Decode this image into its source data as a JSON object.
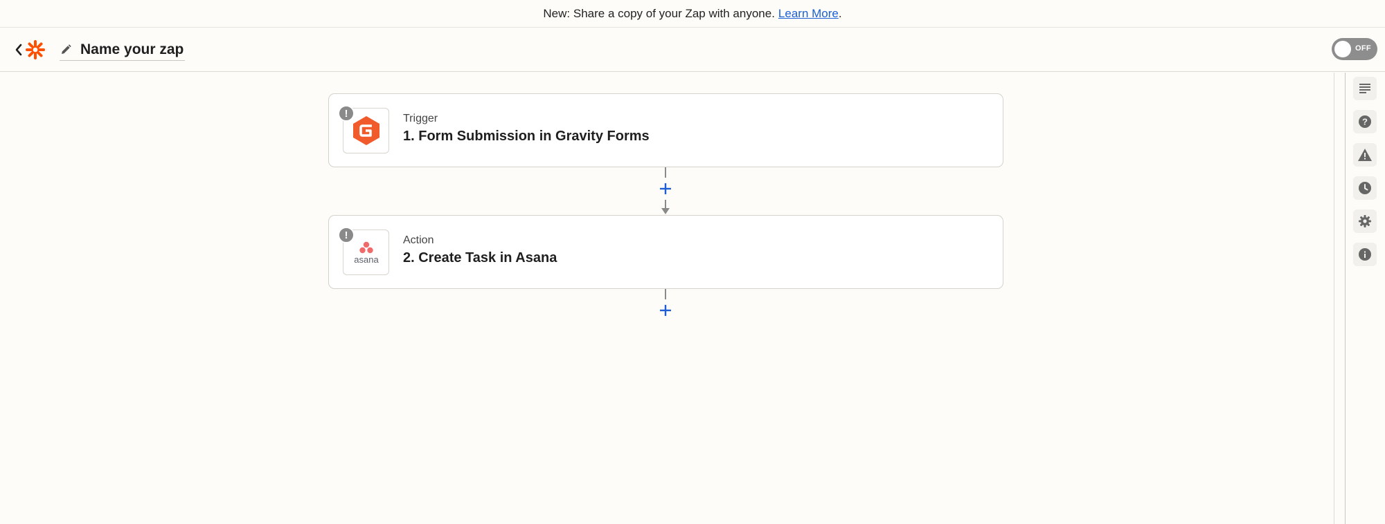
{
  "banner": {
    "text": "New: Share a copy of your Zap with anyone.",
    "link": "Learn More",
    "suffix": "."
  },
  "header": {
    "zap_name": "Name your zap",
    "toggle_label": "OFF",
    "toggle_on": false
  },
  "steps": [
    {
      "kind": "Trigger",
      "name": "1. Form Submission in Gravity Forms",
      "app": "gravity-forms",
      "warning": "!"
    },
    {
      "kind": "Action",
      "name": "2. Create Task in Asana",
      "app": "asana",
      "app_wordmark": "asana",
      "warning": "!"
    }
  ],
  "sidebar": {
    "items": [
      "outline-icon",
      "help-icon",
      "alert-icon",
      "history-icon",
      "settings-icon",
      "info-icon"
    ]
  },
  "colors": {
    "zapier_orange": "#ff4f00",
    "gravity_orange": "#f15a2b",
    "asana_coral": "#f06a6a",
    "add_blue": "#1c5fd4",
    "link_blue": "#1c5fd4"
  }
}
